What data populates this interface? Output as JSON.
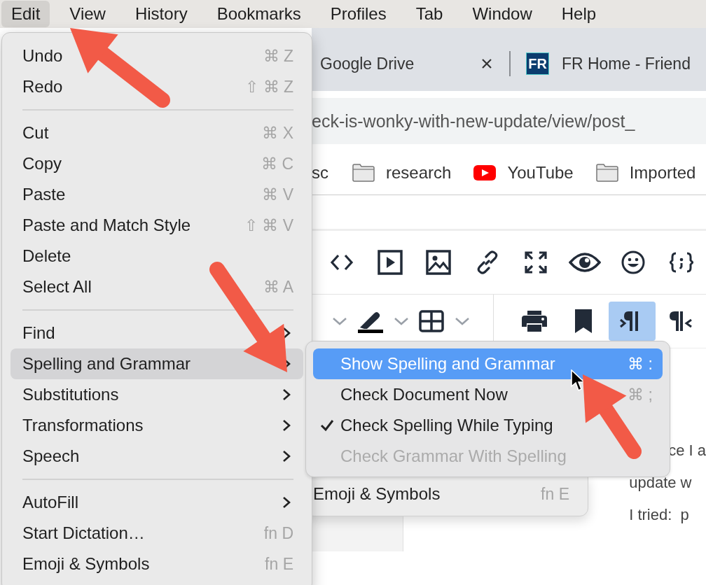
{
  "menubar": {
    "items": [
      {
        "label": "Edit",
        "selected": true
      },
      {
        "label": "View",
        "selected": false
      },
      {
        "label": "History",
        "selected": false
      },
      {
        "label": "Bookmarks",
        "selected": false
      },
      {
        "label": "Profiles",
        "selected": false
      },
      {
        "label": "Tab",
        "selected": false
      },
      {
        "label": "Window",
        "selected": false
      },
      {
        "label": "Help",
        "selected": false
      }
    ]
  },
  "browser": {
    "tabs": [
      {
        "title": "Google Drive",
        "closable": true
      },
      {
        "title": "FR Home - Friend",
        "favicon_text": "FR",
        "closable": false
      }
    ],
    "address": "eck-is-wonky-with-new-update/view/post_",
    "bookmarks": [
      {
        "label": "sc",
        "kind": "plain"
      },
      {
        "label": "research",
        "kind": "folder"
      },
      {
        "label": "YouTube",
        "kind": "video"
      },
      {
        "label": "Imported",
        "kind": "folder"
      }
    ],
    "toolbar_top": [
      {
        "kind": "code"
      },
      {
        "kind": "video"
      },
      {
        "kind": "image"
      },
      {
        "kind": "link"
      },
      {
        "kind": "expand"
      },
      {
        "kind": "eye"
      },
      {
        "kind": "emoji"
      },
      {
        "kind": "braces"
      }
    ],
    "toolbar_bottom_left": [
      {
        "kind": "dropdown"
      },
      {
        "kind": "highlight"
      },
      {
        "kind": "dropdown"
      },
      {
        "kind": "table"
      },
      {
        "kind": "dropdown"
      }
    ],
    "toolbar_bottom": [
      {
        "kind": "print",
        "selected": false
      },
      {
        "kind": "bookmark",
        "selected": false
      },
      {
        "kind": "rtl",
        "selected": true
      },
      {
        "kind": "ltr",
        "selected": false
      }
    ],
    "post_lines": [
      "ce I a",
      "update w",
      "I tried:  p"
    ]
  },
  "edit_menu": {
    "sections": [
      {
        "items": [
          {
            "label": "Undo",
            "kind": "command",
            "shortcut": "⌘ Z",
            "selected": false
          },
          {
            "label": "Redo",
            "kind": "command",
            "shortcut": "⇧ ⌘ Z",
            "selected": false
          }
        ]
      },
      {
        "items": [
          {
            "label": "Cut",
            "kind": "command",
            "shortcut": "⌘ X",
            "selected": false
          },
          {
            "label": "Copy",
            "kind": "command",
            "shortcut": "⌘ C",
            "selected": false
          },
          {
            "label": "Paste",
            "kind": "command",
            "shortcut": "⌘ V",
            "selected": false
          },
          {
            "label": "Paste and Match Style",
            "kind": "command",
            "shortcut": "⇧ ⌘ V",
            "selected": false
          },
          {
            "label": "Delete",
            "kind": "command",
            "selected": false
          },
          {
            "label": "Select All",
            "kind": "command",
            "shortcut": "⌘ A",
            "selected": false
          }
        ]
      },
      {
        "items": [
          {
            "label": "Find",
            "kind": "submenu",
            "selected": false
          },
          {
            "label": "Spelling and Grammar",
            "kind": "submenu",
            "selected": true
          },
          {
            "label": "Substitutions",
            "kind": "submenu",
            "selected": false
          },
          {
            "label": "Transformations",
            "kind": "submenu",
            "selected": false
          },
          {
            "label": "Speech",
            "kind": "submenu",
            "selected": false
          }
        ]
      },
      {
        "items": [
          {
            "label": "AutoFill",
            "kind": "submenu",
            "selected": false
          },
          {
            "label": "Start Dictation…",
            "kind": "command",
            "shortcut": "fn D",
            "selected": false
          },
          {
            "label": "Emoji & Symbols",
            "kind": "command",
            "shortcut": "fn E",
            "selected": false
          }
        ]
      }
    ]
  },
  "spelling_submenu": {
    "items": [
      {
        "label": "Show Spelling and Grammar",
        "shortcut": "⌘ :",
        "selected": true,
        "checked": false,
        "disabled": false
      },
      {
        "label": "Check Document Now",
        "shortcut": "⌘ ;",
        "selected": false,
        "checked": false,
        "disabled": false
      },
      {
        "label": "Check Spelling While Typing",
        "selected": false,
        "checked": true,
        "disabled": false
      },
      {
        "label": "Check Grammar With Spelling",
        "selected": false,
        "checked": false,
        "disabled": true
      }
    ]
  },
  "background_menu": {
    "label": "Emoji & Symbols",
    "shortcut": "fn E"
  }
}
